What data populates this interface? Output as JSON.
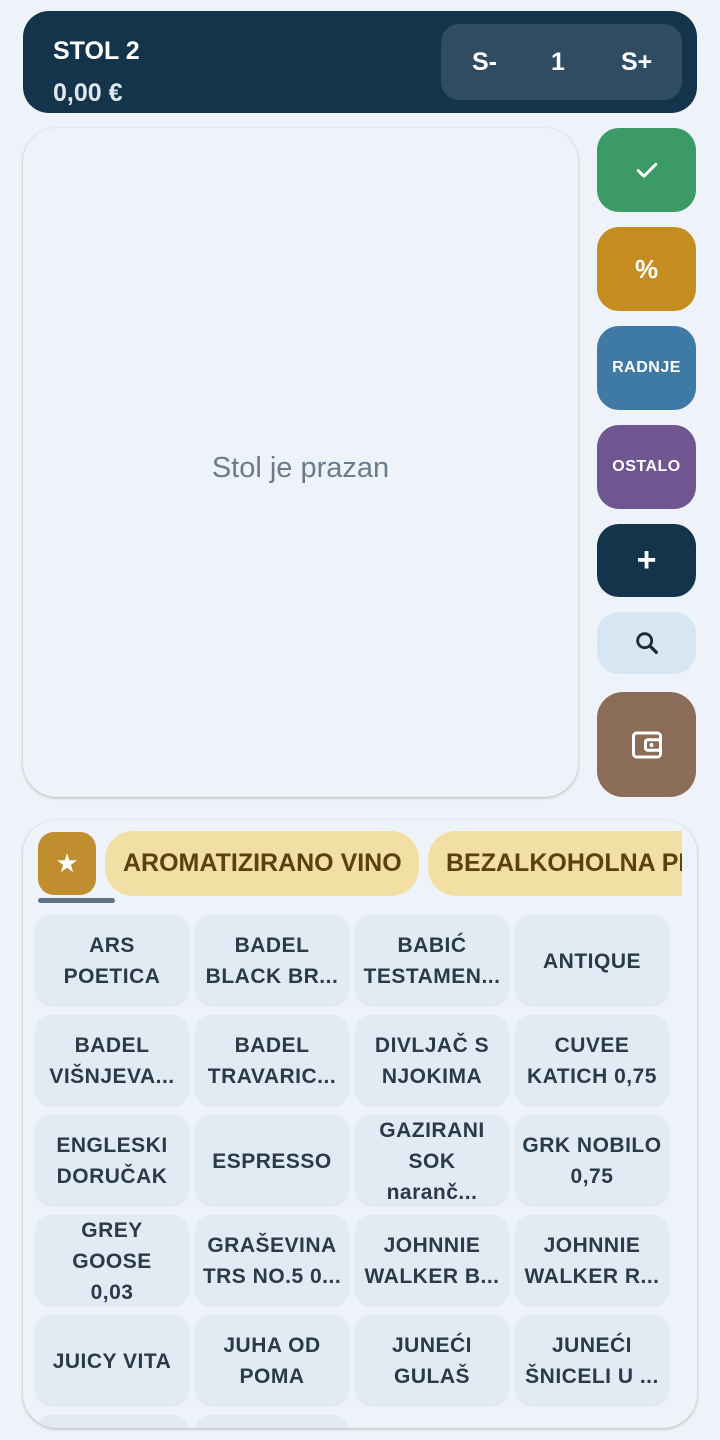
{
  "header": {
    "title": "STOL 2",
    "total": "0,00 €",
    "seat_minus": "S-",
    "seat_count": "1",
    "seat_plus": "S+"
  },
  "order": {
    "empty_text": "Stol je prazan"
  },
  "actions": {
    "confirm_icon": "check-icon",
    "percent_label": "%",
    "radnje_label": "RADNJE",
    "ostalo_label": "OSTALO",
    "plus_label": "+",
    "search_icon": "search-icon",
    "wallet_icon": "wallet-icon"
  },
  "categories": {
    "favorite_icon": "★",
    "items": [
      "AROMATIZIRANO VINO",
      "BEZALKOHOLNA PIĆA"
    ]
  },
  "products": [
    [
      "ARS",
      "POETICA"
    ],
    [
      "BADEL",
      "BLACK BR..."
    ],
    [
      "BABIĆ",
      "TESTAMEN..."
    ],
    [
      "ANTIQUE",
      ""
    ],
    [
      "BADEL",
      "VIŠNJEVA..."
    ],
    [
      "BADEL",
      "TRAVARIC..."
    ],
    [
      "DIVLJAČ S",
      "NJOKIMA"
    ],
    [
      "CUVEE",
      "KATICH 0,75"
    ],
    [
      "ENGLESKI",
      "DORUČAK"
    ],
    [
      "ESPRESSO",
      ""
    ],
    [
      "GAZIRANI",
      "SOK naranč..."
    ],
    [
      "GRK NOBILO",
      "0,75"
    ],
    [
      "GREY GOOSE",
      "0,03"
    ],
    [
      "GRAŠEVINA",
      "TRS NO.5 0..."
    ],
    [
      "JOHNNIE",
      "WALKER B..."
    ],
    [
      "JOHNNIE",
      "WALKER R..."
    ],
    [
      "JUICY VITA",
      ""
    ],
    [
      "JUHA OD",
      "POMA"
    ],
    [
      "JUNEĆI",
      "GULAŠ"
    ],
    [
      "JUNEĆI",
      "ŠNICELI U ..."
    ]
  ],
  "colors": {
    "header_bg": "#14344c",
    "confirm": "#3c9a66",
    "percent": "#c58c20",
    "radnje": "#3f7aa6",
    "ostalo": "#6f5690",
    "wallet": "#8a6c58",
    "category": "#f2dfa3"
  }
}
